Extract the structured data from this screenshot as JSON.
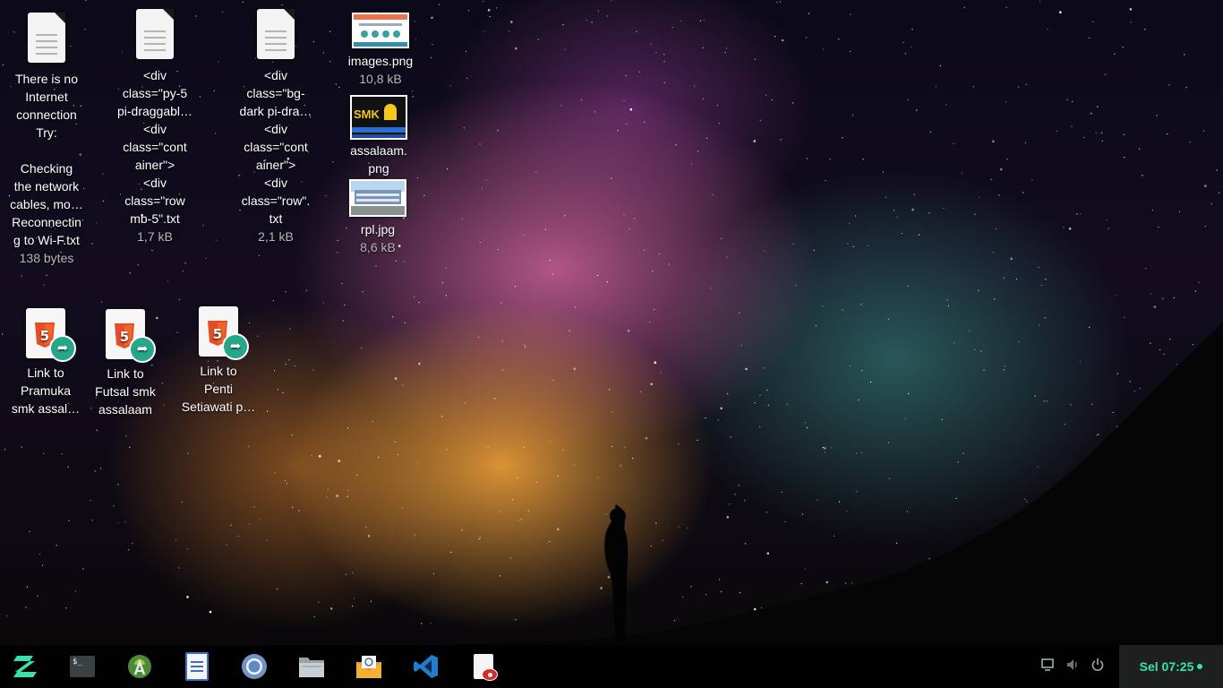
{
  "desktop": {
    "files": [
      {
        "label": "There is no\nInternet\nconnection\nTry:\n\nChecking\nthe network\ncables, mo…\nReconnectin\ng to Wi-F.txt",
        "size": "138 bytes",
        "icon": "text-file-icon"
      },
      {
        "label": "<div\nclass=\"py-5\npi-draggabl…\n<div\nclass=\"cont\nainer\">\n<div\nclass=\"row\nmb-5\".txt",
        "size": "1,7 kB",
        "icon": "text-file-icon"
      },
      {
        "label": "<div\nclass=\"bg-\ndark pi-dra…\n<div\nclass=\"cont\nainer\">\n<div\nclass=\"row\".\ntxt",
        "size": "2,1 kB",
        "icon": "text-file-icon"
      },
      {
        "label": "images.png",
        "size": "10,8 kB",
        "icon": "image-thumbnail-icon"
      },
      {
        "label": "assalaam.\npng",
        "size": "",
        "icon": "smk-logo-thumbnail-icon"
      },
      {
        "label": "rpl.jpg",
        "size": "8,6 kB",
        "icon": "photo-thumbnail-icon"
      },
      {
        "label": "Link to\nPramuka\nsmk assal…",
        "size": "",
        "icon": "html5-link-icon"
      },
      {
        "label": "Link to\nFutsal smk\nassalaam",
        "size": "",
        "icon": "html5-link-icon"
      },
      {
        "label": "Link to\nPenti\nSetiawati p…",
        "size": "",
        "icon": "html5-link-icon"
      }
    ],
    "thumbnail_text": {
      "smk": "SMK"
    }
  },
  "taskbar": {
    "apps": [
      {
        "name": "zorin-menu-icon"
      },
      {
        "name": "terminal-icon",
        "glyph": "$_"
      },
      {
        "name": "android-studio-icon"
      },
      {
        "name": "text-editor-icon"
      },
      {
        "name": "chromium-icon"
      },
      {
        "name": "files-icon"
      },
      {
        "name": "mail-icon"
      },
      {
        "name": "vscode-icon"
      },
      {
        "name": "document-viewer-icon"
      }
    ],
    "tray": {
      "display_icon": "display-icon",
      "volume_icon": "volume-icon",
      "power_icon": "power-icon"
    },
    "clock": "Sel 07:25"
  },
  "colors": {
    "accent": "#3be0b0",
    "link_badge": "#25a88a",
    "html5_orange": "#e44d26"
  }
}
